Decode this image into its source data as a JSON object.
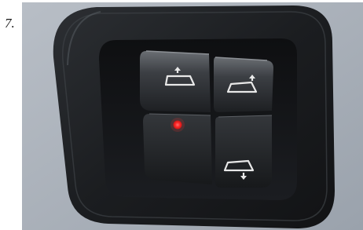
{
  "figure": {
    "number_label": "7."
  },
  "photo": {
    "subject": "switch-panel",
    "icons": [
      "van-rear-door-up-icon",
      "van-side-door-up-icon",
      "van-side-door-down-icon"
    ],
    "indicator_color": "#ff2a2a"
  }
}
